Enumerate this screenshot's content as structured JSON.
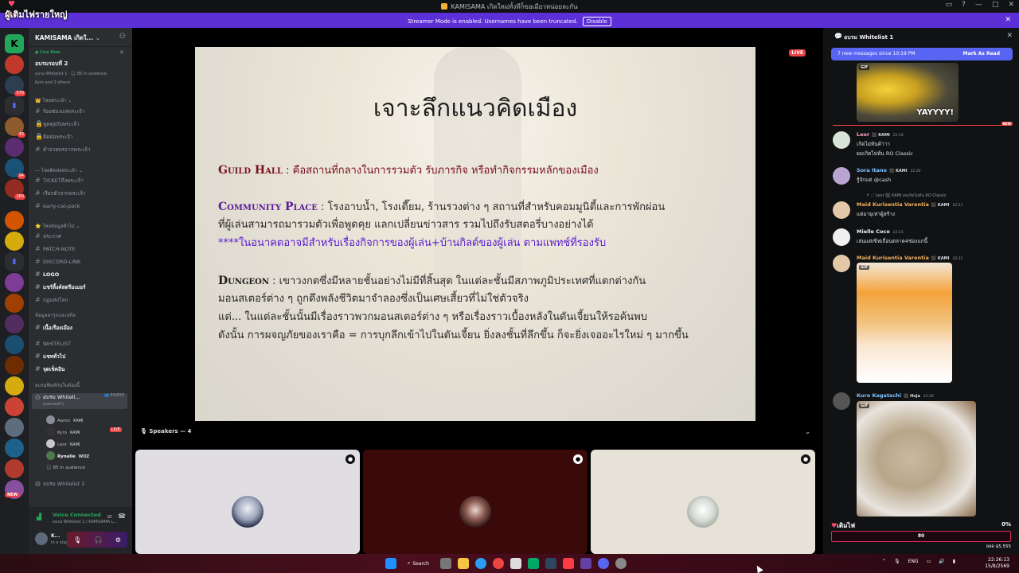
{
  "window": {
    "title": "KAMISAMA เกิดใหม่ทั้งทีก็ขอเมียวหน่อยละกัน",
    "overlay_title": "ผู้เติมไฟรายใหญ่"
  },
  "banner": {
    "text": "Streamer Mode is enabled. Usernames have been truncated.",
    "disable_label": "Disable"
  },
  "rail": {
    "badges": [
      "32",
      "570",
      "43",
      "94",
      "160"
    ],
    "new_label": "NEW"
  },
  "sidebar": {
    "server_name": "KAMISAMA เกิดใ...",
    "live_now": "Live Now",
    "stage_title": "อบรมรอบที่ 2",
    "stage_meta": "อบรม Whitelist 1 · 🎧 85 in audience",
    "stage_others": "Kyro and 3 others",
    "categories": {
      "c1": "ไชยพระเจ้า",
      "c2": "ไชยติดต่อพระเจ้า",
      "c3": "ไชยข้อมูลทั่วไป",
      "c4": "ข้อมูลอารุธและสกิล",
      "c5": "อบรมพินท์กันในห้องนี้"
    },
    "channels": [
      "ร้อยซ่องแฟพระเจ้า",
      "พูดคุยกับพระเจ้า",
      "ติดต่อพระเจ้า",
      "คำอวยพรจากพระเจ้า",
      "TICKETถึงพระเจ้า",
      "เรียกตัวจากพระเจ้า",
      "early-cat-pack",
      "ประกาศ",
      "PATCH-NOTE",
      "DISCORD-LINK",
      "LOGO",
      "แชร์ลิ้งค์สตรีมเมอร์",
      "กฎแห่งโลก",
      "เนื้อเรื่องเมือง",
      "WHITELIST",
      "แชททั่วไป",
      "จุดเช็คอิน"
    ],
    "voice_channel": "อบรม Whiteli...",
    "voice_channel_sub": "อบรมรอบที่ 2",
    "voice_channel_count": "89",
    "voice_channel_cap": "/650",
    "voice_users": [
      {
        "name": "Aaron",
        "tag": "KAMI"
      },
      {
        "name": "Kyro",
        "tag": "KAMI",
        "live": "LIVE"
      },
      {
        "name": "Leor",
        "tag": "KAMI"
      },
      {
        "name": "Rynelle",
        "tag": "WOZ"
      }
    ],
    "voice_audience": "85 in audience",
    "voice_channel_2": "อบรม Whitelist 2"
  },
  "voice_panel": {
    "status": "Voice Connected",
    "sub": "อบรม Whitelist 1 / KAMISAMA L...",
    "user_name": "K...",
    "user_status": "In a stage"
  },
  "stage": {
    "live_badge": "LIVE",
    "slide": {
      "title": "เจาะลึกแนวคิดเมือง",
      "guild_kw": "Guild Hall",
      "guild_text": " : คือสถานที่กลางในการรวมตัว รับภารกิจ หรือทำกิจกรรมหลักของเมือง",
      "community_kw": "Community Place",
      "community_text": " : โรงอาบน้ำ, โรงเตี๊ยม, ร้านรวงต่าง ๆ สถานที่สำหรับคอมมูนิตี้และการพักผ่อน",
      "community_line2": "ที่ผู้เล่นสามารถมารวมตัวเพื่อพูดคุย แลกเปลี่ยนข่าวสาร รวมไปถึงรับสตอรี่บางอย่างได้",
      "community_line3": "****ในอนาคตอาจมีสำหรับเรื่องกิจการของผู้เล่น+บ้านกิลด์ของผู้เล่น ตามแพทช์ที่รองรับ",
      "dungeon_kw": "Dungeon",
      "dungeon_text": " : เขาวงกตซึ่งมีหลายชั้นอย่างไม่มีที่สิ้นสุด ในแต่ละชั้นมีสภาพภูมิประเทศที่แตกต่างกัน",
      "dungeon_line2": "มอนสเตอร์ต่าง ๆ ถูกดึงพลังชีวิตมาจำลองซึ่งเป็นเศษเสี้ยวที่ไม่ใช่ตัวจริง",
      "dungeon_line3": "แต่... ในแต่ละชั้นนั้นมีเรื่องราวพวกมอนสเตอร์ต่าง ๆ หรือเรื่องราวเบื้องหลังในดันเจี้ยนให้รอค้นพบ",
      "dungeon_line4": "ดังนั้น การผจญภัยของเราคือ = การบุกลึกเข้าไปในดันเจี้ยน ยิ่งลงชั้นที่ลึกขึ้น ก็จะยิ่งเจออะไรใหม่ ๆ มากขึ้น"
    },
    "speakers_label": "Speakers — 4"
  },
  "chat": {
    "title": "อบรม Whitelist 1",
    "new_messages": "7 new messages since 10:19 PM",
    "mark_read": "Mark As Read",
    "gif_caption": "YAYYYY!",
    "gif_label": "GIF",
    "new_label": "NEW",
    "messages": [
      {
        "name": "Leor",
        "tag": "KAMI",
        "time": "22:19",
        "lines": [
          "เกิดไม่ทันค้าาา",
          "ผมเกิดไม่ทัน RO Classic"
        ]
      },
      {
        "name": "Sora Itano",
        "tag": "KAMI",
        "time": "22:20",
        "lines": [
          "รู้จักแต่ @cash"
        ]
      },
      {
        "reply": "ผมเกิดไม่ทัน RO Classic",
        "name": "Maid Kurisentia Varentia",
        "tag": "KAMI",
        "time": "22:21",
        "lines": [
          "แต่อายุเท่าผู้สร้าง"
        ]
      },
      {
        "name": "Mielle Coco",
        "time": "22:21",
        "lines": [
          "เล่นแต่เซิฟเถื่อนตลาด4ช่องแกนี้"
        ]
      },
      {
        "name": "Maid Kurisentia Varentia",
        "tag": "KAMI",
        "time": "22:21",
        "lines": []
      },
      {
        "name": "Kuro Kagatachi",
        "tag": "Hoja",
        "time": "22:26",
        "lines": []
      }
    ],
    "donate": {
      "label": "เติมไฟ",
      "percent": "0%",
      "progress": 0,
      "amount": "80",
      "total": "ยอด $5,555"
    }
  },
  "taskbar": {
    "search": "Search",
    "lang": "ENG",
    "time": "22:26:13",
    "date": "15/8/2569"
  }
}
